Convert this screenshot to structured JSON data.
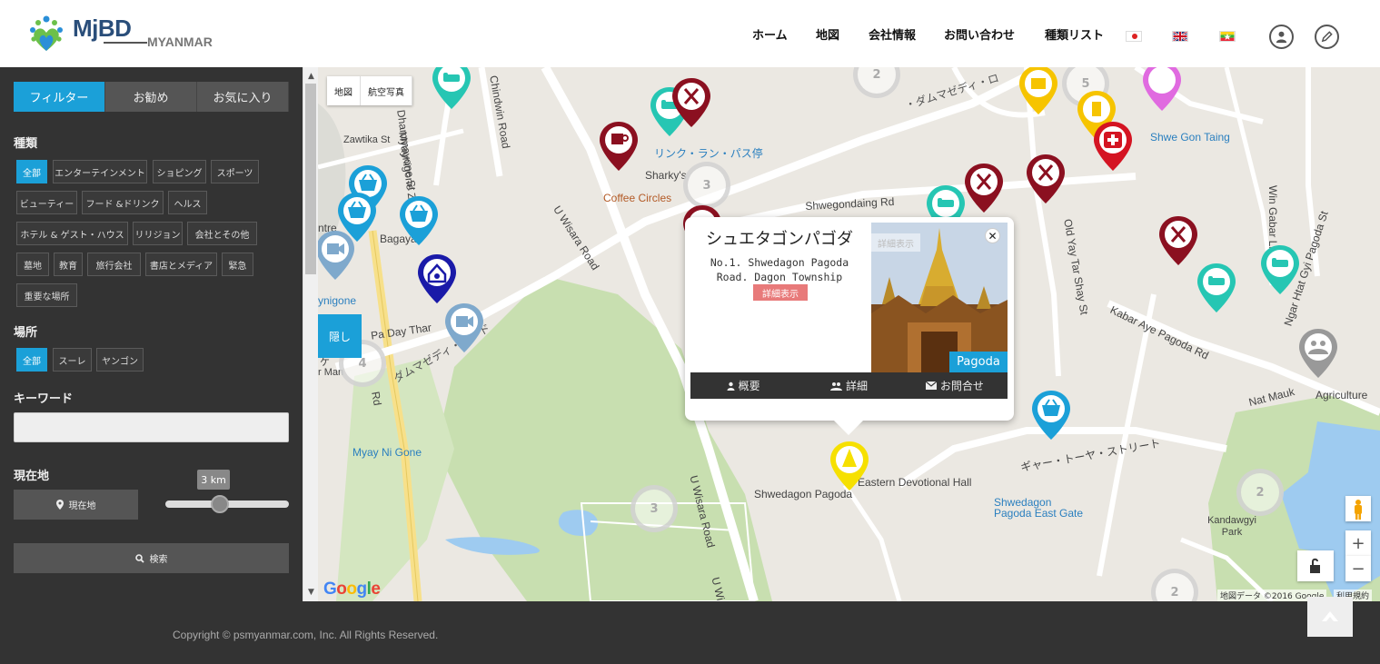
{
  "header": {
    "logo_text": "MjBD",
    "logo_sub": "MYANMAR",
    "nav": [
      {
        "label": "ホーム"
      },
      {
        "label": "地図"
      },
      {
        "label": "会社情報"
      },
      {
        "label": "お問い合わせ"
      },
      {
        "label": "種類リスト"
      }
    ]
  },
  "sidebar": {
    "tabs": [
      {
        "label": "フィルター",
        "active": true
      },
      {
        "label": "お勧め",
        "active": false
      },
      {
        "label": "お気に入り",
        "active": false
      }
    ],
    "category_title": "種類",
    "categories": [
      {
        "label": "全部",
        "active": true
      },
      {
        "label": "エンターテインメント"
      },
      {
        "label": "ショピング"
      },
      {
        "label": "スポーツ"
      },
      {
        "label": "ビューティー"
      },
      {
        "label": "フード &ドリンク"
      },
      {
        "label": "ヘルス"
      },
      {
        "label": "ホテル & ゲスト・ハウス"
      },
      {
        "label": "リリジョン"
      },
      {
        "label": "会社とその他"
      },
      {
        "label": "墓地"
      },
      {
        "label": "教育"
      },
      {
        "label": "旅行会社"
      },
      {
        "label": "書店とメディア"
      },
      {
        "label": "緊急"
      },
      {
        "label": "重要な場所"
      }
    ],
    "location_title": "場所",
    "locations": [
      {
        "label": "全部",
        "active": true
      },
      {
        "label": "スーレ"
      },
      {
        "label": "ヤンゴン"
      }
    ],
    "keyword_title": "キーワード",
    "keyword_value": "",
    "current_title": "現在地",
    "current_button": "現在地",
    "radius_label": "3 km",
    "radius_value": 3,
    "search_button": "検索"
  },
  "map": {
    "type_buttons": [
      "地図",
      "航空写真"
    ],
    "hide_button": "隠し",
    "labels": {
      "dhammayone": "Dhammayone St",
      "zawtika": "Zawtika St",
      "chindwin": "Chindwin Road",
      "uwisara1": "U Wisara Road",
      "uwisara2": "U Wisara Road",
      "shwegondaing": "Shwegondaing Rd",
      "sharky": "Sharky's",
      "coffee": "Coffee Circles",
      "bagaya": "Bagaya",
      "padaythar": "Pa Day Thar",
      "myaynigone": "Myay Ni Gone",
      "eastern_hall": "Eastern Devotional Hall",
      "shwedagon_pagoda": "Shwedagon Pagoda",
      "east_gate": "Shwedagon Pagoda East Gate",
      "old_yay_tar": "Old Yay Tar Shay St",
      "kabar_aye": "Kabar Aye Pagoda Rd",
      "nat_mauk": "Nat Mauk",
      "agriculture": "Agriculture",
      "kandawgyi": "Kandawgyi Park",
      "shwe_gon_taing": "Shwe Gon Taing",
      "ngar_htat_gyi": "Ngar Htat Gyi Pagoda St",
      "win_gabar": "Win Gabar Ln",
      "ring_ran": "リンク・ラン・パス停",
      "damuzedi": "ダムマゼディ・ロード",
      "damuzedi2": "・ダムマゼディ・ロ",
      "gyar_tawyar": "ギャー・トーヤ・ストリート",
      "u_wi": "U Wi",
      "rd": "Rd",
      "ntre": "ntre",
      "ynigone": "ynigone",
      "rman": "r Man",
      "ke": "ケ"
    },
    "clusters": [
      "2",
      "5",
      "3",
      "4",
      "3",
      "2",
      "2"
    ],
    "attribution": "地図データ ©2016 Google",
    "terms": "利用規約",
    "google": "Google"
  },
  "popup": {
    "title": "シュエタゴンパゴダ",
    "address": "No.1. Shwedagon Pagoda Road. Dagon Township",
    "detail_button": "詳細表示",
    "badge": "Pagoda",
    "ghost": "詳細表示",
    "bar": [
      {
        "label": "概要",
        "icon": "user-icon"
      },
      {
        "label": "詳細",
        "icon": "users-icon"
      },
      {
        "label": "お問合せ",
        "icon": "envelope-icon"
      }
    ]
  },
  "footer": {
    "copyright": "Copyright © psmyanmar.com, Inc. All Rights Reserved."
  },
  "colors": {
    "accent": "#1ba0d8",
    "sidebar_bg": "#333333",
    "map_bg": "#ebe8e2",
    "park": "#c8dfb0",
    "water": "#9ecbf0",
    "road_yellow": "#f7e08a",
    "detail_red": "#e87a7a"
  }
}
